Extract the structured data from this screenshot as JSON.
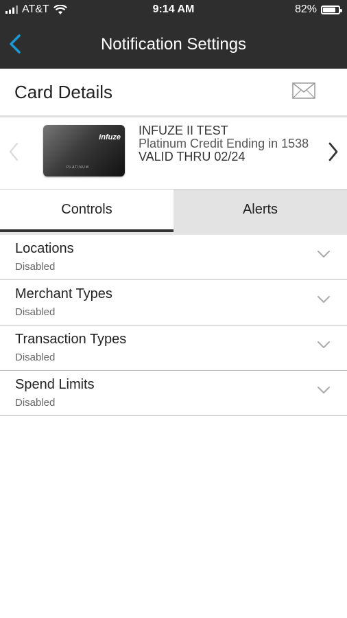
{
  "status_bar": {
    "carrier": "AT&T",
    "time": "9:14 AM",
    "battery_percent": "82%",
    "battery_level": 0.82
  },
  "nav": {
    "title": "Notification Settings"
  },
  "card_header": {
    "label": "Card Details"
  },
  "card": {
    "name": "INFUZE II TEST",
    "description": "Platinum Credit Ending in 1538",
    "valid_thru": "VALID THRU 02/24",
    "brand": "infuze",
    "tier": "PLATINUM"
  },
  "tabs": [
    {
      "label": "Controls",
      "active": true
    },
    {
      "label": "Alerts",
      "active": false
    }
  ],
  "controls": [
    {
      "title": "Locations",
      "status": "Disabled"
    },
    {
      "title": "Merchant Types",
      "status": "Disabled"
    },
    {
      "title": "Transaction Types",
      "status": "Disabled"
    },
    {
      "title": "Spend Limits",
      "status": "Disabled"
    }
  ],
  "colors": {
    "nav_background": "#2e2e2e",
    "back_arrow": "#1a9bd7",
    "inactive_tab": "#e3e3e3"
  }
}
